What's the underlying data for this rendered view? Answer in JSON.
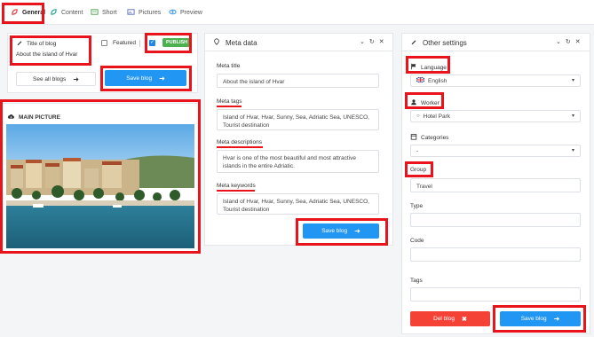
{
  "tabs": [
    {
      "label": "General"
    },
    {
      "label": "Content"
    },
    {
      "label": "Short"
    },
    {
      "label": "Pictures"
    },
    {
      "label": "Preview"
    }
  ],
  "left": {
    "title_label": "Title of blog",
    "title_value": "About the island of Hvar",
    "featured_label": "Featured",
    "publish_badge": "PUBLISH",
    "see_all_label": "See all blogs",
    "save_label": "Save blog",
    "main_picture_label": "MAIN PICTURE"
  },
  "meta": {
    "header": "Meta data",
    "title_label": "Meta title",
    "title_value": "About the island of Hvar",
    "tags_label": "Meta tags",
    "tags_value": "Island of Hvar, Hvar, Sunny, Sea, Adriatic Sea, UNESCO, Tourist destination",
    "desc_label": "Meta descriptions",
    "desc_value": "Hvar is one of the most beautiful and most attractive islands in the entire Adriatic.",
    "keywords_label": "Meta keywords",
    "keywords_value": "Island of Hvar, Hvar, Sunny, Sea, Adriatic Sea, UNESCO, Tourist destination",
    "save_label": "Save blog"
  },
  "other": {
    "header": "Other settings",
    "language_label": "Language",
    "language_value": "English",
    "worker_label": "Worker",
    "worker_value": "Hotel Park",
    "categories_label": "Categories",
    "categories_value": "-",
    "group_label": "Group",
    "group_value": "Travel",
    "type_label": "Type",
    "code_label": "Code",
    "tags_label": "Tags",
    "del_label": "Del blog",
    "save_label": "Save blog"
  },
  "colors": {
    "accent_blue": "#2196f3",
    "danger_red": "#f44336",
    "publish_green": "#4caf50",
    "highlight_red": "#e8131b"
  }
}
